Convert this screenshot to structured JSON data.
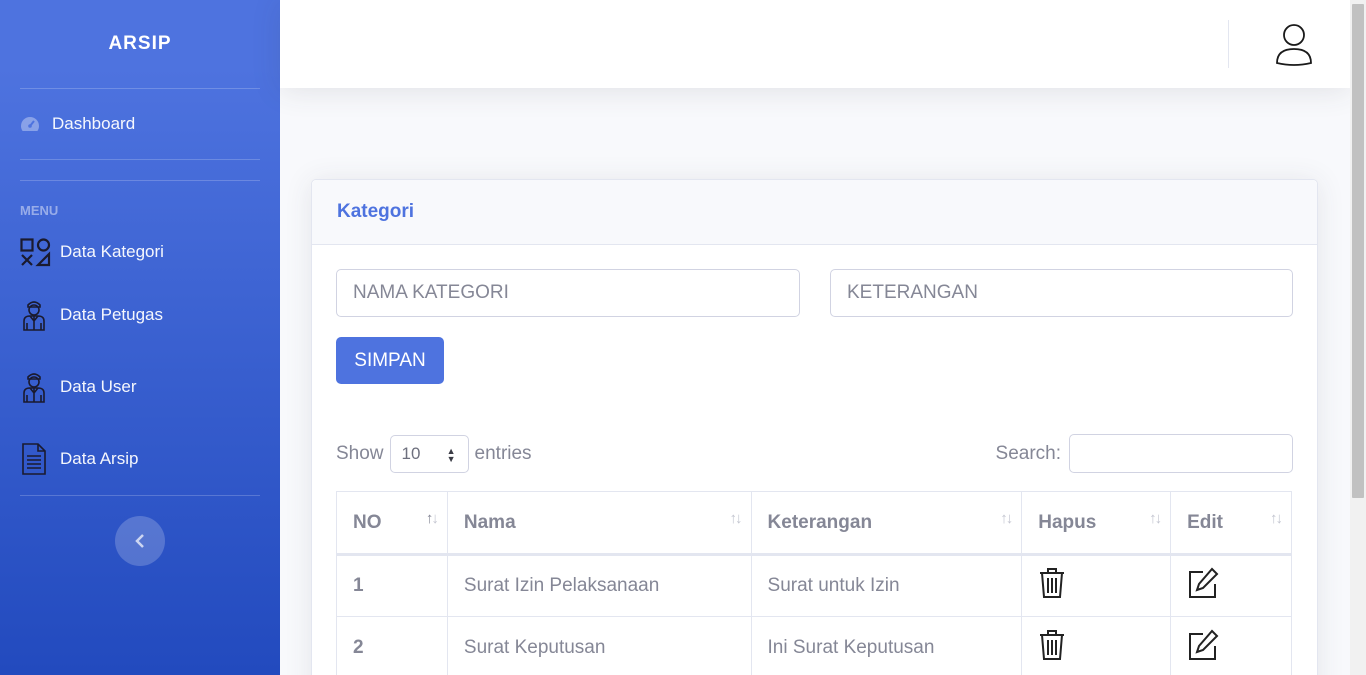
{
  "sidebar": {
    "brand": "ARSIP",
    "dashboard": "Dashboard",
    "heading": "MENU",
    "items": [
      {
        "label": "Data Kategori",
        "icon": "shapes-icon"
      },
      {
        "label": "Data Petugas",
        "icon": "officer-icon"
      },
      {
        "label": "Data User",
        "icon": "user-officer-icon"
      },
      {
        "label": "Data Arsip",
        "icon": "document-icon"
      }
    ],
    "toggle": "‹"
  },
  "topbar": {
    "user_icon": "user-profile-icon"
  },
  "card": {
    "title": "Kategori",
    "nama_placeholder": "NAMA KATEGORI",
    "keterangan_placeholder": "KETERANGAN",
    "save_label": "SIMPAN"
  },
  "table_controls": {
    "show_label": "Show",
    "entries_value": "10",
    "entries_label": "entries",
    "search_label": "Search:"
  },
  "table": {
    "headers": [
      "NO",
      "Nama",
      "Keterangan",
      "Hapus",
      "Edit"
    ],
    "rows": [
      {
        "no": "1",
        "nama": "Surat Izin Pelaksanaan",
        "keterangan": "Surat untuk Izin"
      },
      {
        "no": "2",
        "nama": "Surat Keputusan",
        "keterangan": "Ini Surat Keputusan"
      }
    ]
  },
  "colors": {
    "primary": "#4e73df",
    "primary_dark": "#224abe",
    "text": "#858796"
  }
}
